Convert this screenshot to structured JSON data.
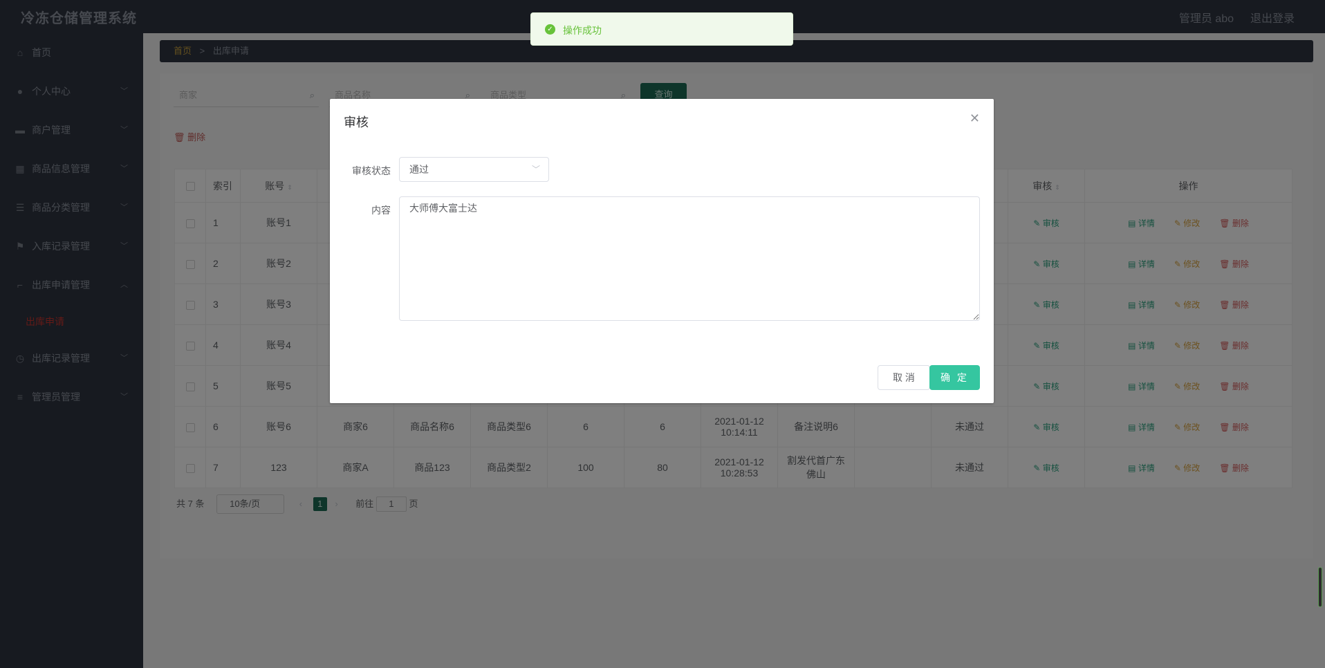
{
  "app": {
    "title": "冷冻仓储管理系统",
    "admin": "管理员 abo",
    "logout": "退出登录"
  },
  "sidebar": {
    "items": [
      {
        "label": "首页",
        "icon": "home-icon"
      },
      {
        "label": "个人中心",
        "icon": "user-icon"
      },
      {
        "label": "商户管理",
        "icon": "monitor-icon"
      },
      {
        "label": "商品信息管理",
        "icon": "grid-icon"
      },
      {
        "label": "商品分类管理",
        "icon": "sliders-icon"
      },
      {
        "label": "入库记录管理",
        "icon": "flag-icon"
      },
      {
        "label": "出库申请管理",
        "icon": "crop-icon"
      },
      {
        "label": "出库记录管理",
        "icon": "clock-icon"
      },
      {
        "label": "管理员管理",
        "icon": "menu-icon"
      }
    ],
    "sub_active": "出库申请"
  },
  "breadcrumb": {
    "home": "首页",
    "separator": ">",
    "current": "出库申请"
  },
  "search": {
    "merchant_placeholder": "商家",
    "product_name_placeholder": "商品名称",
    "product_type_placeholder": "商品类型",
    "query_label": "查询"
  },
  "toolbar": {
    "delete_label": "删除"
  },
  "table": {
    "headers": {
      "index": "索引",
      "account": "账号",
      "audit": "审核",
      "ops": "操作"
    },
    "rows": [
      {
        "index": "1",
        "account": "账号1"
      },
      {
        "index": "2",
        "account": "账号2"
      },
      {
        "index": "3",
        "account": "账号3"
      },
      {
        "index": "4",
        "account": "账号4"
      },
      {
        "index": "5",
        "account": "账号5"
      },
      {
        "index": "6",
        "account": "账号6",
        "merchant": "商家6",
        "product": "商品名称6",
        "type": "商品类型6",
        "qty": "6",
        "out_qty": "6",
        "date": "2021-01-12",
        "time": "10:14:11",
        "note": "备注说明6",
        "status": "未通过"
      },
      {
        "index": "7",
        "account": "123",
        "merchant": "商家A",
        "product": "商品123",
        "type": "商品类型2",
        "qty": "100",
        "out_qty": "80",
        "date": "2021-01-12",
        "time": "10:28:53",
        "note_line1": "割发代首广东",
        "note_line2": "佛山",
        "status": "未通过"
      }
    ],
    "ops": {
      "audit": "审核",
      "detail": "详情",
      "edit": "修改",
      "delete": "删除"
    }
  },
  "pagination": {
    "total": "共 7 条",
    "page_size": "10条/页",
    "current_page": "1",
    "goto_prefix": "前往",
    "goto_value": "1",
    "goto_suffix": "页"
  },
  "dialog": {
    "title": "审核",
    "status_label": "审核状态",
    "status_value": "通过",
    "content_label": "内容",
    "content_value": "大师傅大富士达",
    "cancel_label": "取 消",
    "confirm_label": "确 定"
  },
  "toast": {
    "message": "操作成功"
  }
}
